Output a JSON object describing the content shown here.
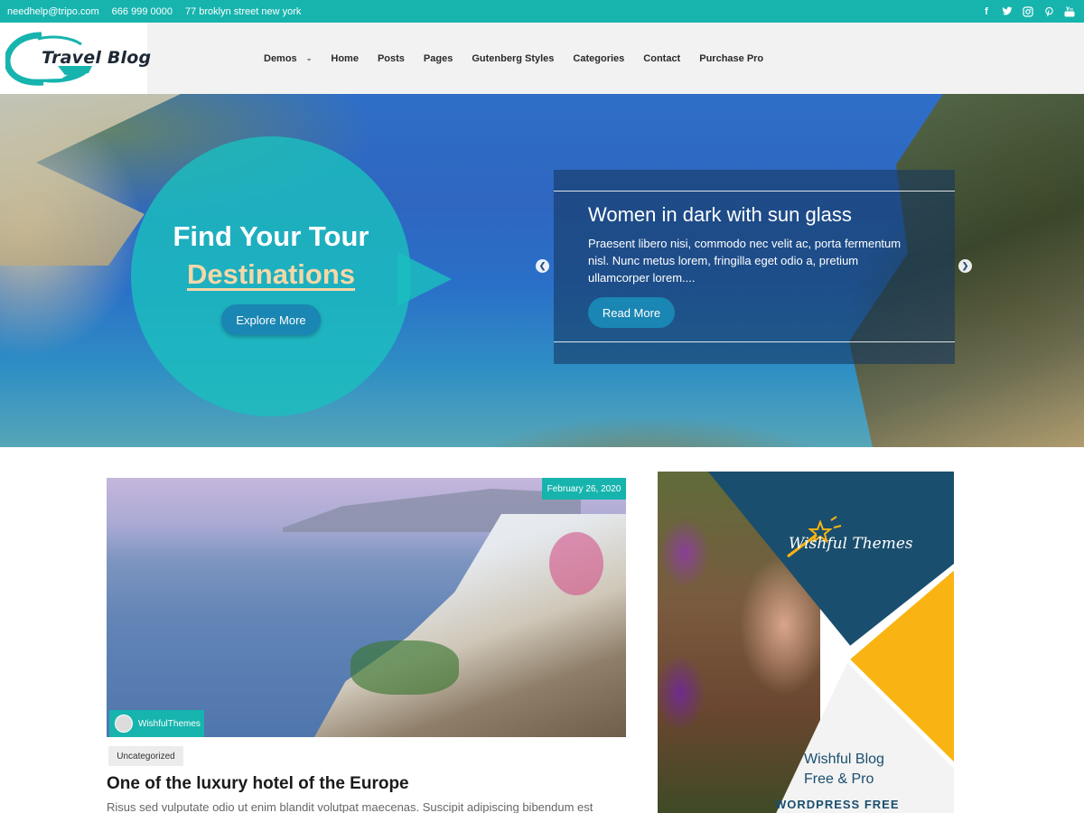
{
  "topbar": {
    "email": "needhelp@tripo.com",
    "phone": "666 999 0000",
    "address": "77 broklyn street new york",
    "social_icons": [
      "facebook-icon",
      "twitter-icon",
      "instagram-icon",
      "pinterest-icon",
      "youtube-icon"
    ]
  },
  "header": {
    "logo_text": "Travel  Blog",
    "nav": [
      "Demos",
      "Home",
      "Posts",
      "Pages",
      "Gutenberg Styles",
      "Categories",
      "Contact",
      "Purchase Pro"
    ]
  },
  "hero": {
    "title_line1": "Find Your Tour",
    "title_line2": "Destinations",
    "explore_label": "Explore More",
    "slide": {
      "title": "Women in dark with sun glass",
      "text": "Praesent libero nisi, commodo nec velit ac, porta fermentum nisl. Nunc metus lorem, fringilla eget odio a, pretium ullamcorper lorem....",
      "read_more_label": "Read More"
    }
  },
  "post": {
    "date": "February 26, 2020",
    "author": "WishfulThemes",
    "category": "Uncategorized",
    "title": "One of the luxury hotel of the Europe",
    "excerpt": "Risus sed vulputate odio ut enim blandit volutpat maecenas. Suscipit adipiscing bibendum est"
  },
  "ad": {
    "brand": "Wishful Themes",
    "line1": "Wishful Blog",
    "line2": "Free & Pro",
    "line3": "WORDPRESS FREE"
  },
  "colors": {
    "accent": "#17b4ae",
    "button": "#1a86b3",
    "navy": "#1a4e6e",
    "yellow": "#f9b413"
  }
}
